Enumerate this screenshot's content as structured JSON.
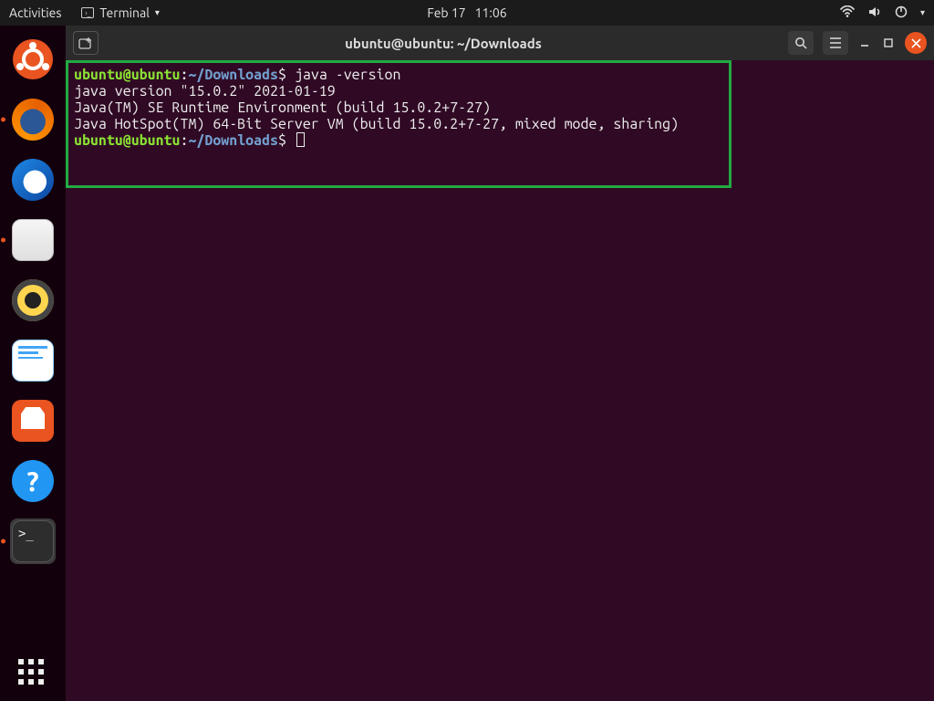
{
  "topbar": {
    "activities": "Activities",
    "app_name": "Terminal",
    "date": "Feb 17",
    "time": "11:06"
  },
  "dock": {
    "items": [
      {
        "name": "ubuntu-logo",
        "running": false
      },
      {
        "name": "firefox",
        "running": true
      },
      {
        "name": "thunderbird",
        "running": false
      },
      {
        "name": "files",
        "running": true
      },
      {
        "name": "rhythmbox",
        "running": false
      },
      {
        "name": "libreoffice-writer",
        "running": false
      },
      {
        "name": "ubuntu-software",
        "running": false
      },
      {
        "name": "help",
        "running": false
      },
      {
        "name": "terminal",
        "running": true,
        "active": true
      }
    ]
  },
  "window": {
    "title": "ubuntu@ubuntu: ~/Downloads"
  },
  "terminal": {
    "prompt_user": "ubuntu@ubuntu",
    "prompt_sep": ":",
    "prompt_path": "~/Downloads",
    "prompt_sym": "$ ",
    "command1": "java -version",
    "out1": "java version \"15.0.2\" 2021-01-19",
    "out2": "Java(TM) SE Runtime Environment (build 15.0.2+7-27)",
    "out3": "Java HotSpot(TM) 64-Bit Server VM (build 15.0.2+7-27, mixed mode, sharing)"
  }
}
